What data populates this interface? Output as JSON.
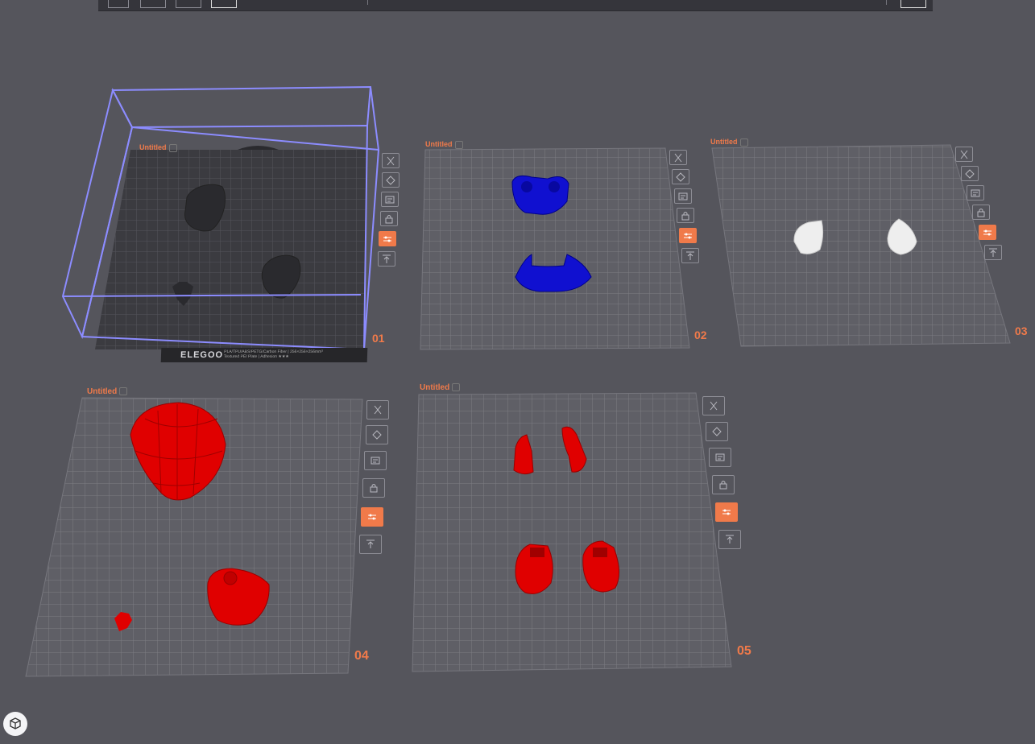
{
  "plates": [
    {
      "title": "Untitled",
      "number": "01"
    },
    {
      "title": "Untitled",
      "number": "02"
    },
    {
      "title": "Untitled",
      "number": "03"
    },
    {
      "title": "Untitled",
      "number": "04"
    },
    {
      "title": "Untitled",
      "number": "05"
    }
  ],
  "brand": {
    "logo": "ELEGOO",
    "line1": "PLA/TPU/ABS/PETG/Carbon Fiber  |  256×256×256mm³",
    "line2": "Textured PEI Plate  |  Adhesion ★★★"
  },
  "plate_buttons": [
    "close-icon",
    "orient-icon",
    "arrange-icon",
    "lock-icon",
    "settings-icon",
    "slice-icon"
  ],
  "colors": {
    "accent": "#f07a4a",
    "plate_bg": "#5f5f66",
    "grid": "#7c7c83",
    "selected_plate": "#3b3b40",
    "bounding_box": "#8c8cff",
    "blue_part": "#1010d0",
    "red_part": "#e00000",
    "white_part": "#eeeeee",
    "dark_part": "#2a2a2e"
  }
}
